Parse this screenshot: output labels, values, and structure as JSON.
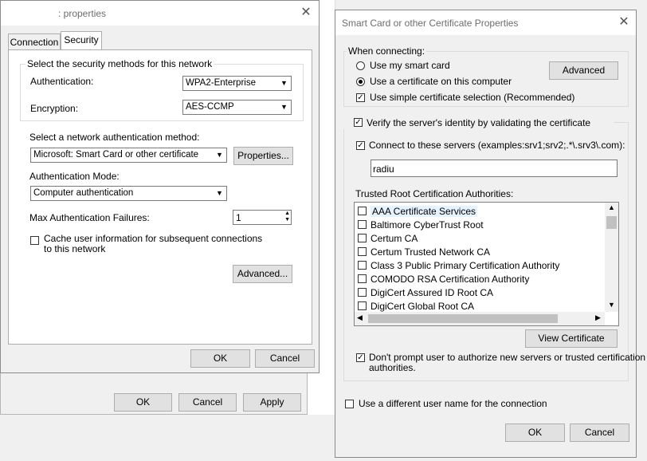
{
  "bg_window": {
    "buttons": {
      "ok": "OK",
      "cancel": "Cancel",
      "apply": "Apply"
    }
  },
  "props": {
    "title": ": properties",
    "tabs": [
      "Connection",
      "Security"
    ],
    "security_group_label": "Select the security methods for this network",
    "authentication_label": "Authentication:",
    "authentication_value": "WPA2-Enterprise",
    "encryption_label": "Encryption:",
    "encryption_value": "AES-CCMP",
    "method_label": "Select a network authentication method:",
    "method_value": "Microsoft: Smart Card or other certificate",
    "properties_button": "Properties...",
    "auth_mode_label": "Authentication Mode:",
    "auth_mode_value": "Computer authentication",
    "max_failures_label": "Max Authentication Failures:",
    "max_failures_value": "1",
    "cache_label_1": "Cache user information for subsequent connections",
    "cache_label_2": "to this network",
    "advanced_button": "Advanced...",
    "ok": "OK",
    "cancel": "Cancel"
  },
  "smart": {
    "title": "Smart Card or other Certificate Properties",
    "when_connecting": "When connecting:",
    "use_smart_card": "Use my smart card",
    "use_certificate": "Use a certificate on this computer",
    "advanced_button": "Advanced",
    "simple_selection": "Use simple certificate selection (Recommended)",
    "verify_identity": "Verify the server's identity by validating the certificate",
    "connect_servers": "Connect to these servers (examples:srv1;srv2;.*\\.srv3\\.com):",
    "servers_value": "radiu",
    "trusted_label": "Trusted Root Certification Authorities:",
    "cas": [
      "AAA Certificate Services",
      "Baltimore CyberTrust Root",
      "Certum CA",
      "Certum Trusted Network CA",
      "Class 3 Public Primary Certification Authority",
      "COMODO RSA Certification Authority",
      "DigiCert Assured ID Root CA",
      "DigiCert Global Root CA"
    ],
    "view_certificate": "View Certificate",
    "dont_prompt_1": "Don't prompt user to authorize new servers or trusted certification",
    "dont_prompt_2": "authorities.",
    "different_user": "Use a different user name for the connection",
    "ok": "OK",
    "cancel": "Cancel"
  }
}
